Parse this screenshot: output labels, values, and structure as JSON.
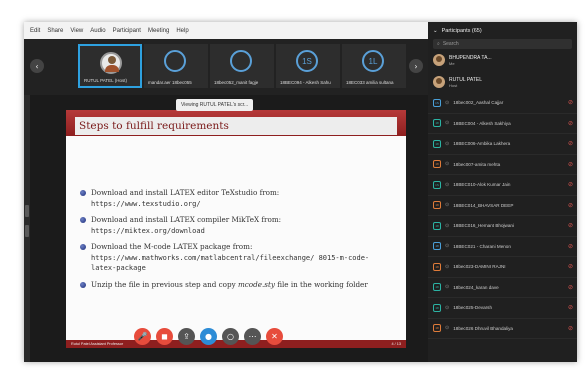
{
  "menu": [
    "Edit",
    "Share",
    "View",
    "Audio",
    "Participant",
    "Meeting",
    "Help"
  ],
  "video_strip": {
    "tiles": [
      {
        "initials": "",
        "name": "RUTUL PATEL (Host)",
        "active": true,
        "photo": true
      },
      {
        "initials": "",
        "name": "mandar.aer 18bec055",
        "active": false,
        "photo": false
      },
      {
        "initials": "",
        "name": "18bec052_manit fagje",
        "active": false,
        "photo": false
      },
      {
        "initials": "1S",
        "name": "18BEC094 - Alkesh Sahu",
        "active": false,
        "photo": false
      },
      {
        "initials": "1L",
        "name": "18EC033 amilia sultana",
        "active": false,
        "photo": false
      }
    ],
    "prev_icon": "‹",
    "next_icon": "›"
  },
  "viewing_banner": "Viewing RUTUL PATEL's scr...",
  "slide": {
    "title": "Steps to fulfill requirements",
    "bullets": [
      {
        "text": "Download and install LATEX editor TeXstudio from:",
        "url": "https://www.texstudio.org/"
      },
      {
        "text": "Download and install LATEX compiler MikTeX from:",
        "url": "https://miktex.org/download"
      },
      {
        "text": "Download the M-code LATEX package from:",
        "url": "https://www.mathworks.com/matlabcentral/fileexchange/ 8015-m-code-latex-package"
      },
      {
        "text_before": "Unzip the file in previous step and copy ",
        "text_em": "mcode.sty",
        "text_after": " file in the working folder"
      }
    ],
    "footer_left": "Rutul Patel Assistant Professor",
    "footer_right": "4 / 13"
  },
  "controls": [
    {
      "name": "mic-off-button",
      "icon": "🎤",
      "color": "#e74c3c"
    },
    {
      "name": "video-off-button",
      "icon": "◼",
      "color": "#e74c3c"
    },
    {
      "name": "share-button",
      "icon": "⇪",
      "color": "#555555"
    },
    {
      "name": "participants-button",
      "icon": "●",
      "color": "#2d8cd6"
    },
    {
      "name": "chat-button",
      "icon": "○",
      "color": "#555555"
    },
    {
      "name": "more-button",
      "icon": "⋯",
      "color": "#555555"
    },
    {
      "name": "leave-button",
      "icon": "✕",
      "color": "#e74c3c"
    }
  ],
  "panel": {
    "title": "Participants (65)",
    "search_placeholder": "Search",
    "hosts": [
      {
        "name": "BHUPENDRA TA...",
        "role": "Me"
      },
      {
        "name": "RUTUL PATEL",
        "role": "Host"
      }
    ],
    "participants": [
      {
        "initials": "1S",
        "name": "18bec002_Aashal Cajjar",
        "color": "#4aa0d8"
      },
      {
        "initials": "18",
        "name": "18BEC004 - Alkesh Sakhiya",
        "color": "#2bb3a4"
      },
      {
        "initials": "18",
        "name": "18BEC006-Ambika Lakhera",
        "color": "#2bb3a4"
      },
      {
        "initials": "18",
        "name": "18bec007-amita mehta",
        "color": "#e07b39"
      },
      {
        "initials": "1S",
        "name": "18BEC010-Alok Kumar Jain",
        "color": "#2bb3a4"
      },
      {
        "initials": "18",
        "name": "18BEC014_BHAVSAR DEEP",
        "color": "#e07b39"
      },
      {
        "initials": "18",
        "name": "18BEC016_Hemant Bhojwani",
        "color": "#2bb3a4"
      },
      {
        "initials": "18",
        "name": "18BEC021 - Charani Menon",
        "color": "#4aa0d8"
      },
      {
        "initials": "18",
        "name": "18bec023-DAMINI RAJNI",
        "color": "#e07b39"
      },
      {
        "initials": "18",
        "name": "18bec024_karan dave",
        "color": "#2bb3a4"
      },
      {
        "initials": "18",
        "name": "18bec025-Devarsh",
        "color": "#2bb3a4"
      },
      {
        "initials": "18",
        "name": "18bec026 Dhruvil Bhandaliya",
        "color": "#e07b39"
      }
    ]
  }
}
